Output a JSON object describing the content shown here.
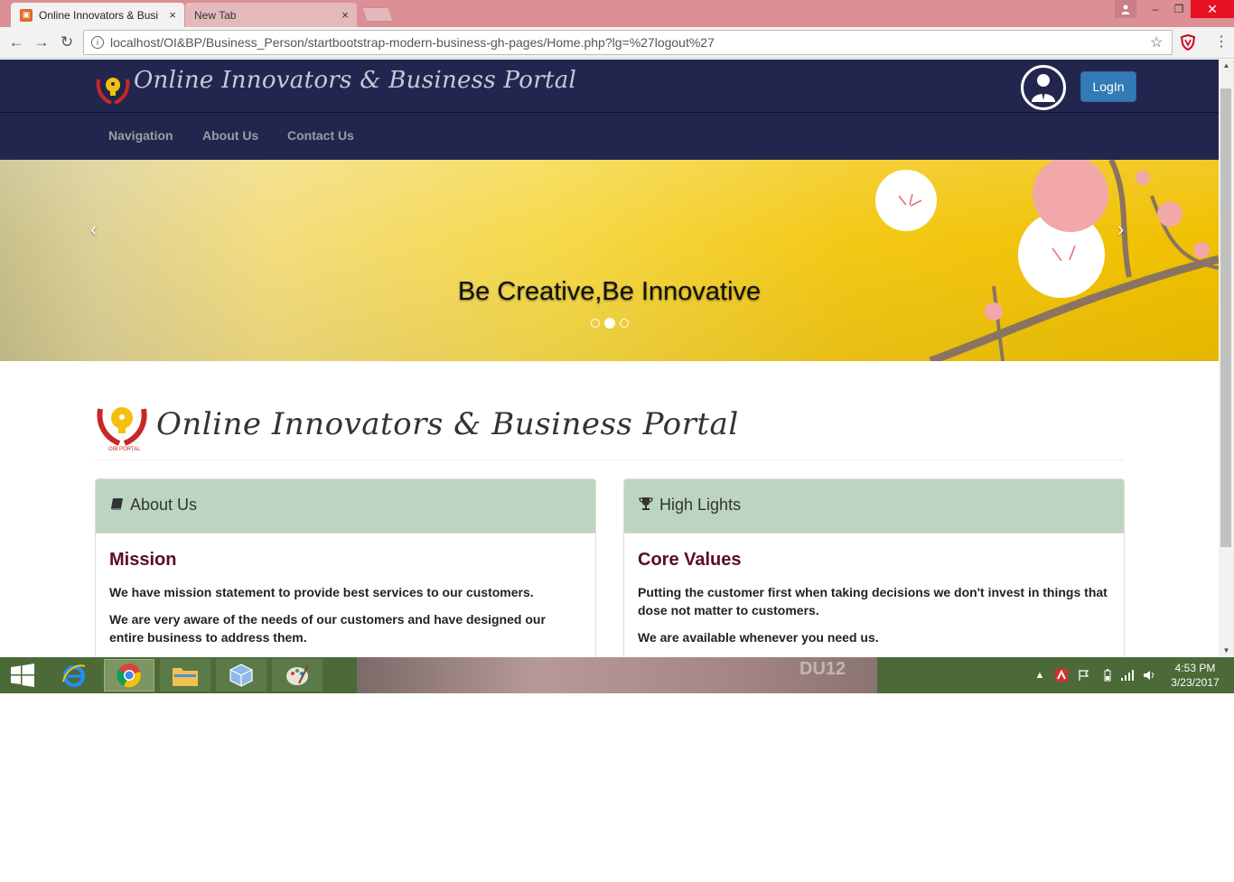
{
  "browser": {
    "tabs": [
      {
        "title": "Online Innovators & Busi",
        "active": true
      },
      {
        "title": "New Tab",
        "active": false
      }
    ],
    "close_glyph": "×",
    "window_controls": {
      "minimize": "–",
      "maximize": "❐",
      "close": "✕"
    },
    "url": "localhost/OI&BP/Business_Person/startbootstrap-modern-business-gh-pages/Home.php?lg=%27logout%27"
  },
  "site": {
    "title": "Online Innovators & Business Portal",
    "login_label": "LogIn",
    "nav": [
      "Navigation",
      "About Us",
      "Contact Us"
    ],
    "logo_small_text": "OIB PORTAL"
  },
  "carousel": {
    "caption": "Be Creative,Be Innovative",
    "prev": "‹",
    "next": "›",
    "active_index": 1
  },
  "content": {
    "page_title": "Online Innovators & Business Portal",
    "panels": [
      {
        "heading": "About Us",
        "icon": "book-icon",
        "title": "Mission",
        "paragraphs": [
          "We have mission statement to provide best services to our customers.",
          "We are very aware of the needs of our customers and have designed our entire business to address them."
        ]
      },
      {
        "heading": "High Lights",
        "icon": "trophy-icon",
        "title": "Core Values",
        "paragraphs": [
          "Putting the customer first when taking decisions we don't invest in things that dose not matter to customers.",
          "We are available whenever you need us."
        ]
      }
    ]
  },
  "taskbar": {
    "time": "4:53 PM",
    "date": "3/23/2017",
    "wallpaper_text": "DU12"
  },
  "colors": {
    "header_bg": "#22264f",
    "panel_heading_bg": "#bcd5c0",
    "panel_title": "#5b0a2e",
    "login_btn": "#337ab7",
    "taskbar_bg": "#4b6a38",
    "tabbar_bg": "#dc8f94"
  }
}
